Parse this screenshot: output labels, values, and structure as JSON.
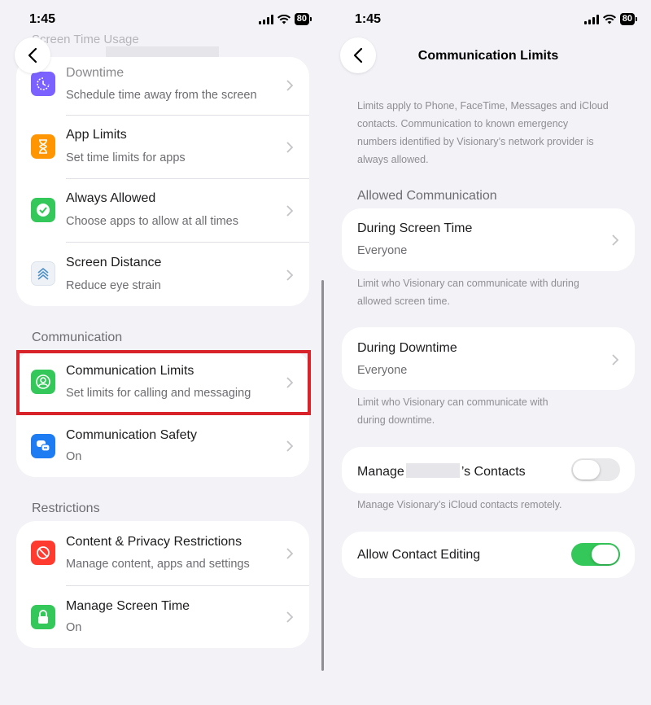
{
  "status": {
    "time": "1:45",
    "battery": "80"
  },
  "left": {
    "faded_header": "Screen Time Usage",
    "screen_time_items": [
      {
        "title": "Downtime",
        "subtitle": "Schedule time away from the screen",
        "icon": "downtime-icon",
        "color": "#7b61ff"
      },
      {
        "title": "App Limits",
        "subtitle": "Set time limits for apps",
        "icon": "hourglass-icon",
        "color": "#ff9500"
      },
      {
        "title": "Always Allowed",
        "subtitle": "Choose apps to allow at all times",
        "icon": "check-badge-icon",
        "color": "#34c759"
      },
      {
        "title": "Screen Distance",
        "subtitle": "Reduce eye strain",
        "icon": "screen-distance-icon",
        "color": "#eef2f6"
      }
    ],
    "communication_header": "Communication",
    "communication_items": [
      {
        "title": "Communication Limits",
        "subtitle": "Set limits for calling and messaging",
        "icon": "person-circle-icon",
        "color": "#34c759"
      },
      {
        "title": "Communication Safety",
        "subtitle": "On",
        "icon": "chat-bubbles-icon",
        "color": "#1e7cf2"
      }
    ],
    "restrictions_header": "Restrictions",
    "restriction_items": [
      {
        "title": "Content & Privacy Restrictions",
        "subtitle": "Manage content, apps and settings",
        "icon": "no-entry-icon",
        "color": "#ff3b30"
      },
      {
        "title": "Manage Screen Time",
        "subtitle": "On",
        "icon": "lock-icon",
        "color": "#34c759"
      }
    ]
  },
  "right": {
    "title": "Communication Limits",
    "intro_lines": [
      "Limits apply to Phone, FaceTime, Messages and iCloud",
      "contacts. Communication to known emergency",
      "numbers identified by Visionary’s network provider is",
      "always allowed."
    ],
    "allowed_header": "Allowed Communication",
    "screen_time": {
      "title": "During Screen Time",
      "value": "Everyone"
    },
    "screen_time_note": [
      "Limit who Visionary can communicate with during",
      "allowed screen time."
    ],
    "downtime": {
      "title": "During Downtime",
      "value": "Everyone"
    },
    "downtime_note": [
      "Limit who Visionary can communicate with",
      "during downtime."
    ],
    "manage_contacts": {
      "prefix": "Manage",
      "suffix": "’s Contacts",
      "enabled": false
    },
    "manage_note": "Manage Visionary’s iCloud contacts remotely.",
    "allow_editing": {
      "title": "Allow Contact Editing",
      "enabled": true
    }
  },
  "colors": {
    "toggle_on": "#34c759",
    "toggle_off": "#e9e9eb",
    "highlight": "#d8232a"
  }
}
